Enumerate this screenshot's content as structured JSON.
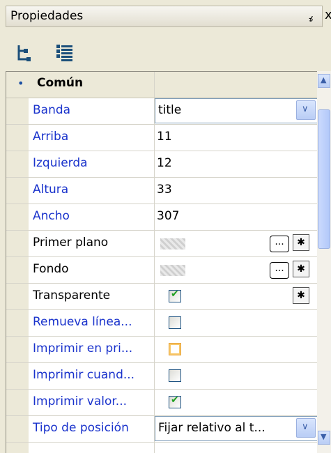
{
  "panel": {
    "title": "Propiedades",
    "pin_glyph": "ߨ",
    "close_glyph": "x"
  },
  "toolbar": {
    "categorized_icon": "categorized-view-icon",
    "alphabetical_icon": "alphabetical-view-icon"
  },
  "category": {
    "label": "Común",
    "icon": "❤"
  },
  "rows": [
    {
      "name": "Banda",
      "value": "title",
      "type": "combo"
    },
    {
      "name": "Arriba",
      "value": "11",
      "type": "text"
    },
    {
      "name": "Izquierda",
      "value": "12",
      "type": "text"
    },
    {
      "name": "Altura",
      "value": "33",
      "type": "text"
    },
    {
      "name": "Ancho",
      "value": "307",
      "type": "text"
    },
    {
      "name": "Primer plano",
      "value": "",
      "type": "color"
    },
    {
      "name": "Fondo",
      "value": "",
      "type": "color"
    },
    {
      "name": "Transparente",
      "value": "",
      "type": "check-reset",
      "checked": true
    },
    {
      "name": "Remueva línea...",
      "value": "",
      "type": "check",
      "checked": false
    },
    {
      "name": "Imprimir en pri...",
      "value": "",
      "type": "check",
      "checked": false
    },
    {
      "name": "Imprimir cuand...",
      "value": "",
      "type": "check",
      "checked": false
    },
    {
      "name": "Imprimir valor...",
      "value": "",
      "type": "check",
      "checked": true
    },
    {
      "name": "Tipo de posición",
      "value": "Fijar relativo al t...",
      "type": "combo"
    }
  ],
  "buttons": {
    "ellipsis": "...",
    "reset": "✱"
  },
  "colors": {
    "property_name_blue": "#1a33cc",
    "background": "#ece9d8"
  }
}
